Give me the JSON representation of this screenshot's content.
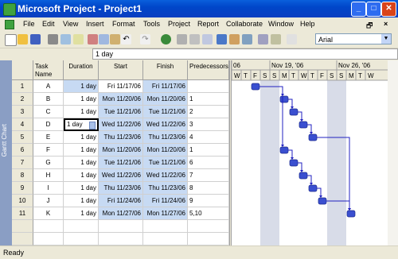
{
  "window": {
    "title": "Microsoft Project - Project1"
  },
  "menu": [
    "File",
    "Edit",
    "View",
    "Insert",
    "Format",
    "Tools",
    "Project",
    "Report",
    "Collaborate",
    "Window",
    "Help"
  ],
  "toolbar": {
    "font": "Arial"
  },
  "entry_bar": {
    "value": "1 day"
  },
  "sidebar": {
    "label": "Gantt Chart"
  },
  "table": {
    "columns": [
      "Task Name",
      "Duration",
      "Start",
      "Finish",
      "Predecessors"
    ],
    "rows": [
      {
        "id": "1",
        "name": "A",
        "duration": "1 day",
        "start": "Fri 11/17/06",
        "finish": "Fri 11/17/06",
        "pred": ""
      },
      {
        "id": "2",
        "name": "B",
        "duration": "1 day",
        "start": "Mon 11/20/06",
        "finish": "Mon 11/20/06",
        "pred": "1"
      },
      {
        "id": "3",
        "name": "C",
        "duration": "1 day",
        "start": "Tue 11/21/06",
        "finish": "Tue 11/21/06",
        "pred": "2"
      },
      {
        "id": "4",
        "name": "D",
        "duration": "1 day",
        "start": "Wed 11/22/06",
        "finish": "Wed 11/22/06",
        "pred": "3"
      },
      {
        "id": "5",
        "name": "E",
        "duration": "1 day",
        "start": "Thu 11/23/06",
        "finish": "Thu 11/23/06",
        "pred": "4"
      },
      {
        "id": "6",
        "name": "F",
        "duration": "1 day",
        "start": "Mon 11/20/06",
        "finish": "Mon 11/20/06",
        "pred": "1"
      },
      {
        "id": "7",
        "name": "G",
        "duration": "1 day",
        "start": "Tue 11/21/06",
        "finish": "Tue 11/21/06",
        "pred": "6"
      },
      {
        "id": "8",
        "name": "H",
        "duration": "1 day",
        "start": "Wed 11/22/06",
        "finish": "Wed 11/22/06",
        "pred": "7"
      },
      {
        "id": "9",
        "name": "I",
        "duration": "1 day",
        "start": "Thu 11/23/06",
        "finish": "Thu 11/23/06",
        "pred": "8"
      },
      {
        "id": "10",
        "name": "J",
        "duration": "1 day",
        "start": "Fri 11/24/06",
        "finish": "Fri 11/24/06",
        "pred": "9"
      },
      {
        "id": "11",
        "name": "K",
        "duration": "1 day",
        "start": "Mon 11/27/06",
        "finish": "Mon 11/27/06",
        "pred": "5,10"
      }
    ]
  },
  "gantt": {
    "weeks": [
      {
        "label": "06"
      },
      {
        "label": "Nov 19, '06"
      },
      {
        "label": "Nov 26, '06"
      }
    ],
    "days": [
      "W",
      "T",
      "F",
      "S",
      "S",
      "M",
      "T",
      "W",
      "T",
      "F",
      "S",
      "S",
      "M",
      "T",
      "W"
    ],
    "bar_color": "#3a4fd0",
    "weekend_color": "#d8dce8"
  },
  "status": {
    "text": "Ready"
  }
}
